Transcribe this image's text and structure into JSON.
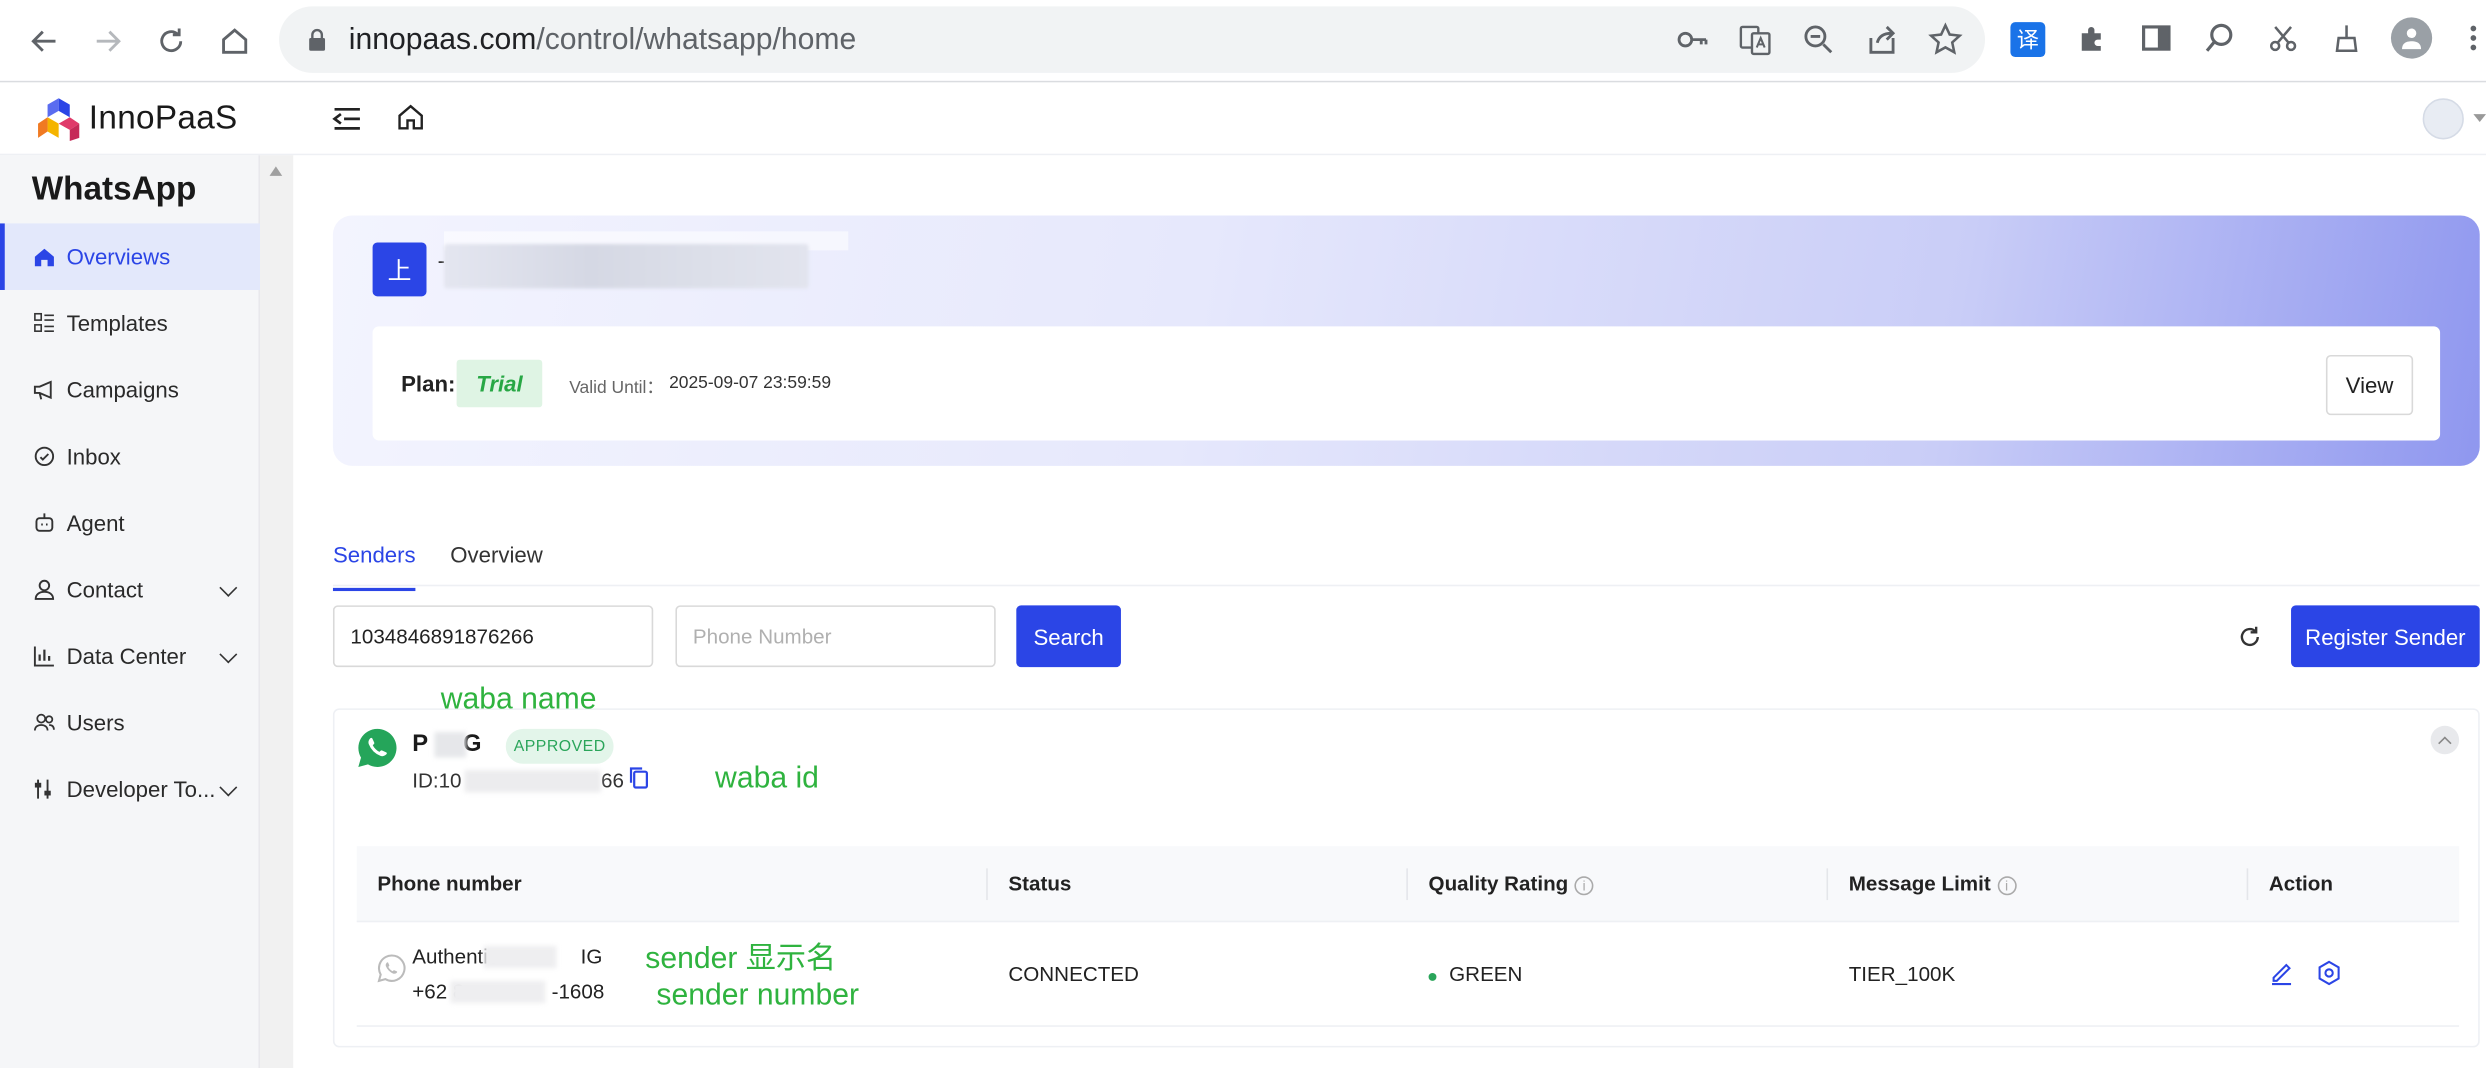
{
  "browser": {
    "url_host": "innopaas.com",
    "url_path": "/control/whatsapp/home",
    "translate_ext_label": "译"
  },
  "header": {
    "logo_text": "InnoPaaS"
  },
  "sidebar": {
    "title": "WhatsApp",
    "items": [
      {
        "label": "Overviews",
        "icon": "home-icon",
        "active": true
      },
      {
        "label": "Templates",
        "icon": "templates-icon"
      },
      {
        "label": "Campaigns",
        "icon": "megaphone-icon"
      },
      {
        "label": "Inbox",
        "icon": "chat-icon"
      },
      {
        "label": "Agent",
        "icon": "robot-icon"
      },
      {
        "label": "Contact",
        "icon": "user-icon",
        "expandable": true
      },
      {
        "label": "Data Center",
        "icon": "chart-icon",
        "expandable": true
      },
      {
        "label": "Users",
        "icon": "users-icon"
      },
      {
        "label": "Developer To...",
        "icon": "developer-icon",
        "expandable": true
      }
    ]
  },
  "banner": {
    "org_badge": "上",
    "org_dash": "-",
    "plan_label": "Plan:",
    "plan_value": "Trial",
    "valid_label": "Valid Until：",
    "valid_value": "2025-09-07 23:59:59",
    "view_button": "View"
  },
  "tabs": [
    {
      "label": "Senders",
      "active": true
    },
    {
      "label": "Overview",
      "active": false
    }
  ],
  "filters": {
    "waba_id_value": "1034846891876266",
    "phone_placeholder": "Phone Number",
    "search_button": "Search",
    "register_button": "Register Sender"
  },
  "waba": {
    "name_start": "P",
    "name_end": "G",
    "status": "APPROVED",
    "id_prefix": "ID:10",
    "id_suffix": "66",
    "table": {
      "headers": [
        "Phone number",
        "Status",
        "Quality Rating",
        "Message Limit",
        "Action"
      ],
      "rows": [
        {
          "display_name_start": "Authentic",
          "display_name_end": "IG",
          "phone_start": "+62 8",
          "phone_end": "-1608",
          "status": "CONNECTED",
          "quality": "GREEN",
          "limit": "TIER_100K"
        }
      ]
    }
  },
  "annotations": {
    "waba_name": "waba name",
    "waba_id": "waba id",
    "sender_display": "sender 显示名",
    "sender_number": "sender number"
  },
  "colors": {
    "primary": "#2b45e6",
    "approved": "#2aa55a",
    "annotation": "#2fb33f"
  }
}
